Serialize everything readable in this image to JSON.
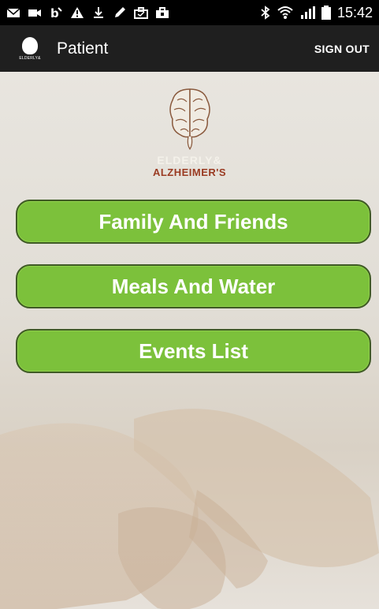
{
  "status_bar": {
    "time": "15:42",
    "left_icons": [
      "mail-icon",
      "video-icon",
      "b-icon",
      "warning-icon",
      "download-icon",
      "pen-icon",
      "briefcase-icon",
      "briefcase-icon"
    ],
    "right_icons": [
      "bluetooth-icon",
      "wifi-icon",
      "signal-icon",
      "battery-icon"
    ]
  },
  "action_bar": {
    "title": "Patient",
    "sign_out_label": "SIGN OUT",
    "logo_text": "ELDERLY&"
  },
  "logo": {
    "line1": "ELDERLY&",
    "line2": "ALZHEIMER'S"
  },
  "menu": {
    "buttons": [
      {
        "label": "Family And Friends"
      },
      {
        "label": "Meals And Water"
      },
      {
        "label": "Events List"
      }
    ]
  },
  "colors": {
    "button_green": "#7cc13b",
    "button_border": "#3f5a25",
    "action_bar": "#1f1f1f",
    "status_bar": "#000000",
    "logo_red": "#9a3b22"
  }
}
